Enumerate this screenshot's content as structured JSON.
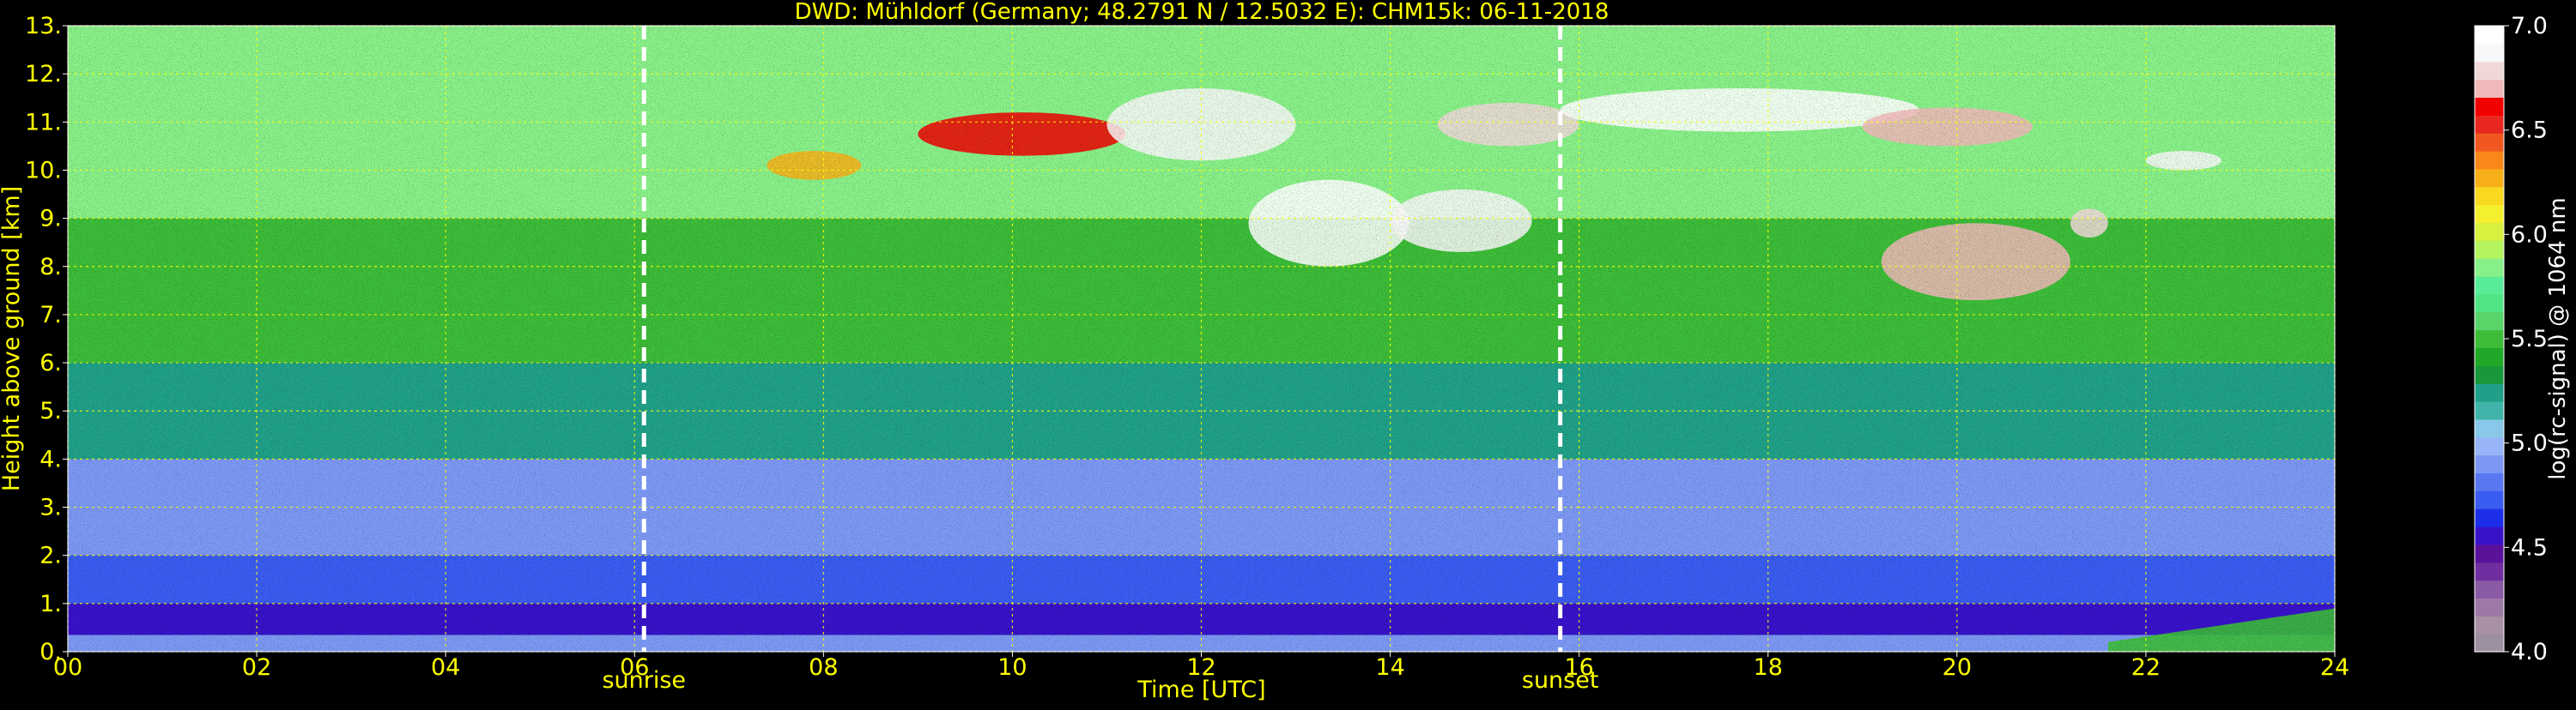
{
  "chart_data": {
    "type": "heatmap",
    "title": "DWD: Mühldorf (Germany; 48.2791 N / 12.5032 E):    CHM15k: 06-11-2018",
    "xlabel": "Time [UTC]",
    "ylabel": "Height above ground [km]",
    "xlim": [
      0,
      24
    ],
    "ylim": [
      0,
      13
    ],
    "x_ticks": [
      "00",
      "02",
      "04",
      "06",
      "08",
      "10",
      "12",
      "14",
      "16",
      "18",
      "20",
      "22",
      "24"
    ],
    "y_ticks": [
      "0.",
      "1.",
      "2.",
      "3.",
      "4.",
      "5.",
      "6.",
      "7.",
      "8.",
      "9.",
      "10.",
      "11.",
      "12.",
      "13."
    ],
    "grid": true,
    "events": [
      {
        "label": "sunrise",
        "time": 6.1
      },
      {
        "label": "sunset",
        "time": 15.8
      }
    ],
    "colorbar": {
      "label": "log(rc-signal) @ 1064 nm",
      "range": [
        4.0,
        7.0
      ],
      "ticks": [
        "4.0",
        "4.5",
        "5.0",
        "5.5",
        "6.0",
        "6.5",
        "7.0"
      ],
      "colors": [
        "#9c8fa0",
        "#a890a6",
        "#9c7aa5",
        "#8a5aa5",
        "#702ea0",
        "#5a129a",
        "#3812c8",
        "#1c2ee8",
        "#3a5cf0",
        "#5878f0",
        "#7c98f4",
        "#98b4f8",
        "#88c8e8",
        "#40b4a8",
        "#20a088",
        "#189838",
        "#20a828",
        "#3cbc38",
        "#58d468",
        "#50e484",
        "#58ec98",
        "#88f088",
        "#b4f460",
        "#d8f040",
        "#f4f030",
        "#f8d820",
        "#f8b018",
        "#f88818",
        "#f05820",
        "#e82820",
        "#f00000",
        "#f0b8b8",
        "#f0d8d8",
        "#f8f8f8",
        "#ffffff"
      ]
    },
    "profile_bands": [
      {
        "height": [
          0.0,
          0.35
        ],
        "value": 4.9
      },
      {
        "height": [
          0.35,
          1.0
        ],
        "value": 4.6
      },
      {
        "height": [
          1.0,
          2.0
        ],
        "value": 4.7
      },
      {
        "height": [
          2.0,
          4.0
        ],
        "value": 4.9
      },
      {
        "height": [
          4.0,
          6.0
        ],
        "value": 5.2
      },
      {
        "height": [
          6.0,
          9.0
        ],
        "value": 5.5
      },
      {
        "height": [
          9.0,
          13.0
        ],
        "value": 5.8
      }
    ],
    "cloud_layers": [
      {
        "time": [
          7.4,
          8.4
        ],
        "height": [
          9.8,
          10.4
        ],
        "value": 6.3
      },
      {
        "time": [
          9.0,
          11.2
        ],
        "height": [
          10.3,
          11.2
        ],
        "value": 6.6
      },
      {
        "time": [
          11.0,
          13.0
        ],
        "height": [
          10.2,
          11.7
        ],
        "value": 6.9
      },
      {
        "time": [
          12.5,
          14.2
        ],
        "height": [
          8.0,
          9.8
        ],
        "value": 7.0
      },
      {
        "time": [
          14.0,
          15.5
        ],
        "height": [
          8.3,
          9.6
        ],
        "value": 6.9
      },
      {
        "time": [
          14.5,
          16.0
        ],
        "height": [
          10.5,
          11.4
        ],
        "value": 6.8
      },
      {
        "time": [
          15.8,
          19.6
        ],
        "height": [
          10.8,
          11.7
        ],
        "value": 7.0
      },
      {
        "time": [
          19.0,
          20.8
        ],
        "height": [
          10.5,
          11.3
        ],
        "value": 6.7
      },
      {
        "time": [
          19.2,
          21.2
        ],
        "height": [
          7.3,
          8.9
        ],
        "value": 6.7
      },
      {
        "time": [
          21.2,
          21.6
        ],
        "height": [
          8.6,
          9.2
        ],
        "value": 6.8
      },
      {
        "time": [
          22.0,
          22.8
        ],
        "height": [
          10.0,
          10.4
        ],
        "value": 6.9
      }
    ],
    "boundary_layer_increase": {
      "time": [
        21.6,
        24.0
      ],
      "height": [
        0.0,
        0.9
      ],
      "value": 5.5
    }
  }
}
